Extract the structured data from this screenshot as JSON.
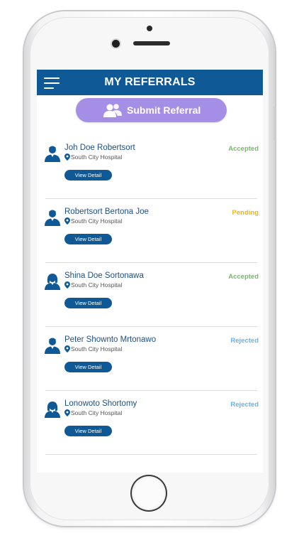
{
  "header": {
    "title": "MY REFERRALS"
  },
  "submit_button": {
    "label": "Submit Referral"
  },
  "colors": {
    "header_bg": "#0f5a96",
    "submit_bg": "#a58fe6",
    "accepted": "#76b86a",
    "pending": "#f0b21e",
    "rejected": "#6cb1e3"
  },
  "referrals": [
    {
      "name": "Joh Doe Robertsort",
      "location": "South City Hospital",
      "status": "Accepted",
      "gender": "male",
      "action": "View Detail"
    },
    {
      "name": "Robertsort Bertona Joe",
      "location": "South City Hospital",
      "status": "Pending",
      "gender": "male",
      "action": "View Detail"
    },
    {
      "name": "Shina Doe Sortonawa",
      "location": "South City Hospital",
      "status": "Accepted",
      "gender": "female",
      "action": "View Detail"
    },
    {
      "name": "Peter Shownto Mrtonawo",
      "location": "South City Hospital",
      "status": "Rejected",
      "gender": "male",
      "action": "View Detail"
    },
    {
      "name": "Lonowoto Shortomy",
      "location": "South City Hospital",
      "status": "Rejected",
      "gender": "female",
      "action": "View Detail"
    }
  ]
}
